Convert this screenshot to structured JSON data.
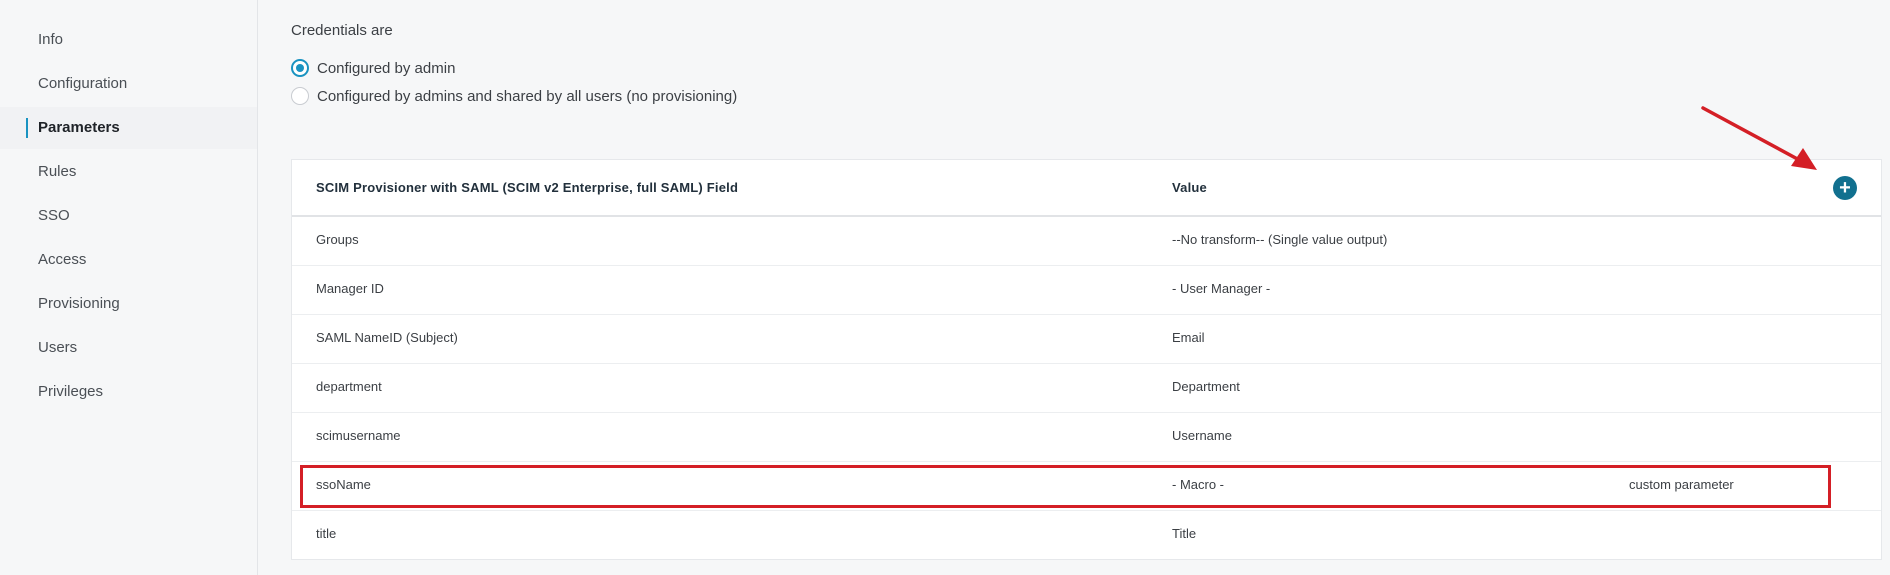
{
  "sidebar": {
    "items": [
      {
        "label": "Info",
        "active": false
      },
      {
        "label": "Configuration",
        "active": false
      },
      {
        "label": "Parameters",
        "active": true
      },
      {
        "label": "Rules",
        "active": false
      },
      {
        "label": "SSO",
        "active": false
      },
      {
        "label": "Access",
        "active": false
      },
      {
        "label": "Provisioning",
        "active": false
      },
      {
        "label": "Users",
        "active": false
      },
      {
        "label": "Privileges",
        "active": false
      }
    ]
  },
  "credentials": {
    "title": "Credentials are",
    "options": [
      {
        "label": "Configured by admin",
        "selected": true
      },
      {
        "label": "Configured by admins and shared by all users (no provisioning)",
        "selected": false
      }
    ]
  },
  "table": {
    "headers": {
      "field": "SCIM Provisioner with SAML (SCIM v2 Enterprise, full SAML) Field",
      "value": "Value"
    },
    "add_button": "+",
    "rows": [
      {
        "field": "Groups",
        "value": "--No transform-- (Single value output)",
        "note": ""
      },
      {
        "field": "Manager ID",
        "value": "- User Manager -",
        "note": ""
      },
      {
        "field": "SAML NameID (Subject)",
        "value": "Email",
        "note": ""
      },
      {
        "field": "department",
        "value": "Department",
        "note": ""
      },
      {
        "field": "scimusername",
        "value": "Username",
        "note": ""
      },
      {
        "field": "ssoName",
        "value": "- Macro -",
        "note": "custom parameter"
      },
      {
        "field": "title",
        "value": "Title",
        "note": ""
      }
    ]
  },
  "colors": {
    "accent": "#1a93c1",
    "add_button": "#11708f",
    "annotation": "#d41f26"
  },
  "icons": {
    "add": "plus-circle-icon",
    "annotation_arrow": "arrow-icon"
  }
}
